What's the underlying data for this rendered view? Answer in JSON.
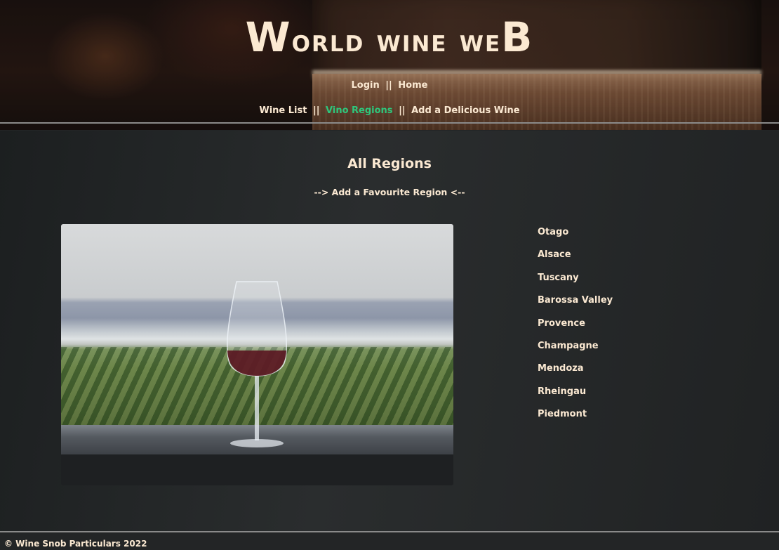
{
  "brand": {
    "title_first": "W",
    "title_rest": "orld wine we",
    "title_last": "B"
  },
  "nav_top": {
    "login": "Login",
    "separator": "||",
    "home": "Home"
  },
  "nav_main": {
    "wine_list": "Wine List",
    "separator": "||",
    "vino_regions": "Vino Regions",
    "add_wine": "Add a Delicious Wine",
    "active_color": "#2ec77c"
  },
  "page": {
    "title": "All Regions",
    "add_region_link": "--> Add a Favourite Region <--"
  },
  "regions": [
    "Otago",
    "Alsace",
    "Tuscany",
    "Barossa Valley",
    "Provence",
    "Champagne",
    "Mendoza",
    "Rheingau",
    "Piedmont"
  ],
  "footer": {
    "text": "© Wine Snob Particulars 2022"
  },
  "colors": {
    "text": "#fbe9d2",
    "background": "#232526"
  }
}
